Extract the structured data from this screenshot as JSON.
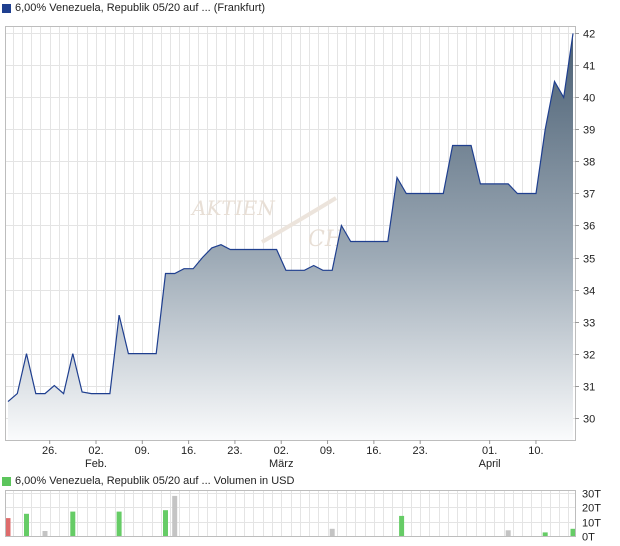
{
  "chart_data": [
    {
      "type": "area",
      "legend_label": "6,00% Venezuela, Republik 05/20 auf ... (Frankfurt)",
      "legend_color": "#1f3f8f",
      "line_color": "#1f3f8f",
      "ylim": [
        29.3,
        42.2
      ],
      "yticks": [
        "30",
        "31",
        "32",
        "33",
        "34",
        "35",
        "36",
        "37",
        "38",
        "39",
        "40",
        "41",
        "42"
      ],
      "xticks": [
        {
          "day": "26.",
          "idx": 9
        },
        {
          "day": "02.",
          "month": "Feb.",
          "idx": 19
        },
        {
          "day": "09.",
          "idx": 29
        },
        {
          "day": "16.",
          "idx": 39
        },
        {
          "day": "23.",
          "idx": 49
        },
        {
          "day": "02.",
          "month": "März",
          "idx": 59
        },
        {
          "day": "09.",
          "idx": 69
        },
        {
          "day": "16.",
          "idx": 79
        },
        {
          "day": "23.",
          "idx": 89
        },
        {
          "day": "01.",
          "month": "April",
          "idx": 104
        },
        {
          "day": "10.",
          "idx": 114
        }
      ],
      "x_count": 123,
      "grid": true,
      "series": [
        {
          "values": [
            [
              0,
              30.5
            ],
            [
              2,
              30.75
            ],
            [
              4,
              32.0
            ],
            [
              6,
              30.75
            ],
            [
              8,
              30.75
            ],
            [
              10,
              31.0
            ],
            [
              12,
              30.75
            ],
            [
              14,
              32.0
            ],
            [
              16,
              30.8
            ],
            [
              18,
              30.75
            ],
            [
              22,
              30.75
            ],
            [
              24,
              33.2
            ],
            [
              26,
              32.0
            ],
            [
              32,
              32.0
            ],
            [
              34,
              34.5
            ],
            [
              36,
              34.5
            ],
            [
              38,
              34.65
            ],
            [
              40,
              34.65
            ],
            [
              42,
              35.0
            ],
            [
              44,
              35.3
            ],
            [
              46,
              35.4
            ],
            [
              48,
              35.25
            ],
            [
              58,
              35.25
            ],
            [
              60,
              34.6
            ],
            [
              64,
              34.6
            ],
            [
              66,
              34.75
            ],
            [
              68,
              34.6
            ],
            [
              70,
              34.6
            ],
            [
              72,
              36.0
            ],
            [
              74,
              35.5
            ],
            [
              82,
              35.5
            ],
            [
              84,
              37.5
            ],
            [
              86,
              37.0
            ],
            [
              94,
              37.0
            ],
            [
              96,
              38.5
            ],
            [
              100,
              38.5
            ],
            [
              102,
              37.3
            ],
            [
              108,
              37.3
            ],
            [
              110,
              37.0
            ],
            [
              114,
              37.0
            ],
            [
              116,
              39.0
            ],
            [
              118,
              40.5
            ],
            [
              120,
              40.0
            ],
            [
              122,
              42.0
            ]
          ]
        }
      ]
    },
    {
      "type": "bar",
      "legend_label": "6,00% Venezuela, Republik 05/20 auf ... Volumen in USD",
      "legend_color": "#5cc55c",
      "ylim": [
        0,
        30
      ],
      "yticks": [
        "0T",
        "10T",
        "20T",
        "30T"
      ],
      "bars": [
        {
          "idx": 0,
          "value": 12.5,
          "color": "#de6b6b"
        },
        {
          "idx": 4,
          "value": 15.5,
          "color": "#66cc66"
        },
        {
          "idx": 8,
          "value": 3.5,
          "color": "#c4c4c4"
        },
        {
          "idx": 14,
          "value": 17.0,
          "color": "#66cc66"
        },
        {
          "idx": 24,
          "value": 17.0,
          "color": "#66cc66"
        },
        {
          "idx": 34,
          "value": 18.0,
          "color": "#66cc66"
        },
        {
          "idx": 36,
          "value": 28.0,
          "color": "#c4c4c4"
        },
        {
          "idx": 70,
          "value": 5.0,
          "color": "#c4c4c4"
        },
        {
          "idx": 85,
          "value": 14.0,
          "color": "#66cc66"
        },
        {
          "idx": 108,
          "value": 4.0,
          "color": "#c4c4c4"
        },
        {
          "idx": 116,
          "value": 2.5,
          "color": "#66cc66"
        },
        {
          "idx": 122,
          "value": 5.0,
          "color": "#66cc66"
        }
      ]
    }
  ]
}
